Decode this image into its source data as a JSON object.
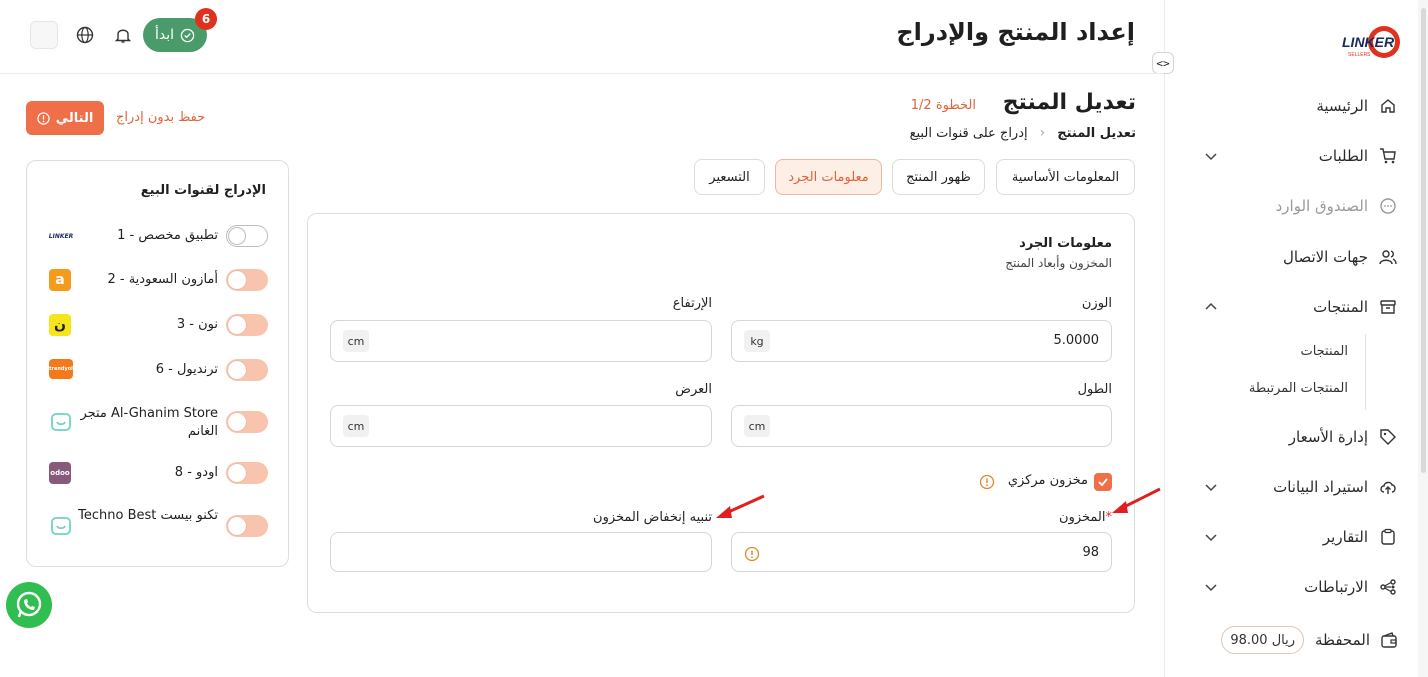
{
  "header": {
    "title": "إعداد المنتج والإدراج",
    "start_button": "ابدأ",
    "notifications_badge": "6"
  },
  "sidebar": {
    "logo_text": "LINKER",
    "logo_subtext": "SELLERS",
    "items": [
      {
        "label": "الرئيسية",
        "icon": "home-icon"
      },
      {
        "label": "الطلبات",
        "icon": "cart-icon"
      },
      {
        "label": "الصندوق الوارد",
        "icon": "chat-icon"
      },
      {
        "label": "جهات الاتصال",
        "icon": "users-icon"
      },
      {
        "label": "المنتجات",
        "icon": "box-icon"
      },
      {
        "label": "إدارة الأسعار",
        "icon": "tag-icon"
      },
      {
        "label": "استيراد البيانات",
        "icon": "upload-cloud-icon"
      },
      {
        "label": "التقارير",
        "icon": "clipboard-icon"
      },
      {
        "label": "الارتباطات",
        "icon": "integrations-icon"
      },
      {
        "label": "المحفظة",
        "icon": "wallet-icon"
      }
    ],
    "sub_items": [
      "المنتجات",
      "المنتجات المرتبطة"
    ],
    "wallet_balance": "98.00 ريال"
  },
  "main": {
    "edit_title": "تعديل المنتج",
    "step_label": "الخطوة 1/2",
    "breadcrumb": {
      "current": "تعديل المنتج",
      "next": "إدراج على قنوات البيع"
    },
    "tabs": [
      {
        "label": "المعلومات الأساسية"
      },
      {
        "label": "ظهور المنتج"
      },
      {
        "label": "معلومات الجرد",
        "active": true
      },
      {
        "label": "التسعير"
      }
    ],
    "next_button": "التالي",
    "save_draft": "حفظ بدون إدراج"
  },
  "inventory": {
    "title": "معلومات الجرد",
    "subtitle": "المخزون وأبعاد المنتج",
    "weight_label": "الوزن",
    "weight_value": "5.0000",
    "weight_unit": "kg",
    "height_label": "الإرتفاع",
    "height_unit": "cm",
    "length_label": "الطول",
    "length_unit": "cm",
    "width_label": "العرض",
    "width_unit": "cm",
    "central_stock_label": "مخزون مركزي",
    "stock_label": "المخزون",
    "stock_required_mark": "*",
    "stock_value": "98",
    "low_stock_label": "تنبيه إنخفاض المخزون",
    "low_stock_value": ""
  },
  "channels": {
    "title": "الإدراج لقنوات البيع",
    "items": [
      {
        "label": "تطبيق مخصص - 1",
        "on": false,
        "logo": "LINKER",
        "logo_color": "#ffffff"
      },
      {
        "label": "أمازون السعودية - 2",
        "on": true,
        "logo": "a",
        "logo_color": "#f59a1b"
      },
      {
        "label": "نون - 3",
        "on": true,
        "logo": "ن",
        "logo_color": "#f6e51b"
      },
      {
        "label": "ترنديول - 6",
        "on": true,
        "logo": "trendyol",
        "logo_color": "#f27a1a"
      },
      {
        "label": "Al-Ghanim Store متجر الغانم",
        "on": true,
        "logo": "",
        "logo_color": "#6fd3c3"
      },
      {
        "label": "اودو - 8",
        "on": true,
        "logo": "odoo",
        "logo_color": "#875a7b"
      },
      {
        "label": "تكنو بيست Techno Best",
        "on": true,
        "logo": "",
        "logo_color": "#6fd3c3"
      }
    ]
  },
  "colors": {
    "accent": "#ef6f48",
    "start_green": "#4a9a6a",
    "badge_red": "#e0301e",
    "arrow_red": "#e02020"
  }
}
